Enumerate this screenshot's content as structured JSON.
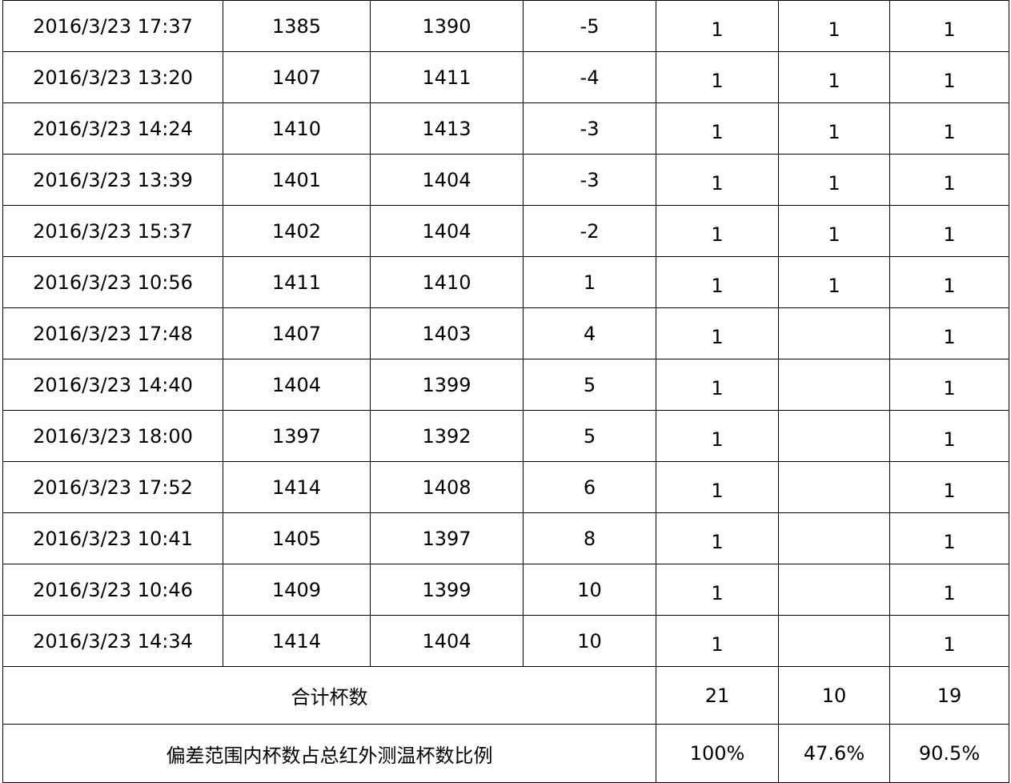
{
  "rows": [
    {
      "time": "2016/3/23 17:37",
      "v1": "1385",
      "v2": "1390",
      "diff": "-5",
      "f1": "1",
      "f2": "1",
      "f3": "1"
    },
    {
      "time": "2016/3/23 13:20",
      "v1": "1407",
      "v2": "1411",
      "diff": "-4",
      "f1": "1",
      "f2": "1",
      "f3": "1"
    },
    {
      "time": "2016/3/23 14:24",
      "v1": "1410",
      "v2": "1413",
      "diff": "-3",
      "f1": "1",
      "f2": "1",
      "f3": "1"
    },
    {
      "time": "2016/3/23 13:39",
      "v1": "1401",
      "v2": "1404",
      "diff": "-3",
      "f1": "1",
      "f2": "1",
      "f3": "1"
    },
    {
      "time": "2016/3/23 15:37",
      "v1": "1402",
      "v2": "1404",
      "diff": "-2",
      "f1": "1",
      "f2": "1",
      "f3": "1"
    },
    {
      "time": "2016/3/23 10:56",
      "v1": "1411",
      "v2": "1410",
      "diff": "1",
      "f1": "1",
      "f2": "1",
      "f3": "1"
    },
    {
      "time": "2016/3/23 17:48",
      "v1": "1407",
      "v2": "1403",
      "diff": "4",
      "f1": "1",
      "f2": "",
      "f3": "1"
    },
    {
      "time": "2016/3/23 14:40",
      "v1": "1404",
      "v2": "1399",
      "diff": "5",
      "f1": "1",
      "f2": "",
      "f3": "1"
    },
    {
      "time": "2016/3/23 18:00",
      "v1": "1397",
      "v2": "1392",
      "diff": "5",
      "f1": "1",
      "f2": "",
      "f3": "1"
    },
    {
      "time": "2016/3/23 17:52",
      "v1": "1414",
      "v2": "1408",
      "diff": "6",
      "f1": "1",
      "f2": "",
      "f3": "1"
    },
    {
      "time": "2016/3/23 10:41",
      "v1": "1405",
      "v2": "1397",
      "diff": "8",
      "f1": "1",
      "f2": "",
      "f3": "1"
    },
    {
      "time": "2016/3/23 10:46",
      "v1": "1409",
      "v2": "1399",
      "diff": "10",
      "f1": "1",
      "f2": "",
      "f3": "1"
    },
    {
      "time": "2016/3/23 14:34",
      "v1": "1414",
      "v2": "1404",
      "diff": "10",
      "f1": "1",
      "f2": "",
      "f3": "1"
    }
  ],
  "total": {
    "label": "合计杯数",
    "values": [
      "21",
      "10",
      "19"
    ]
  },
  "ratio": {
    "label": "偏差范围内杯数占总红外测温杯数比例",
    "values": [
      "100%",
      "47.6%",
      "90.5%"
    ]
  }
}
